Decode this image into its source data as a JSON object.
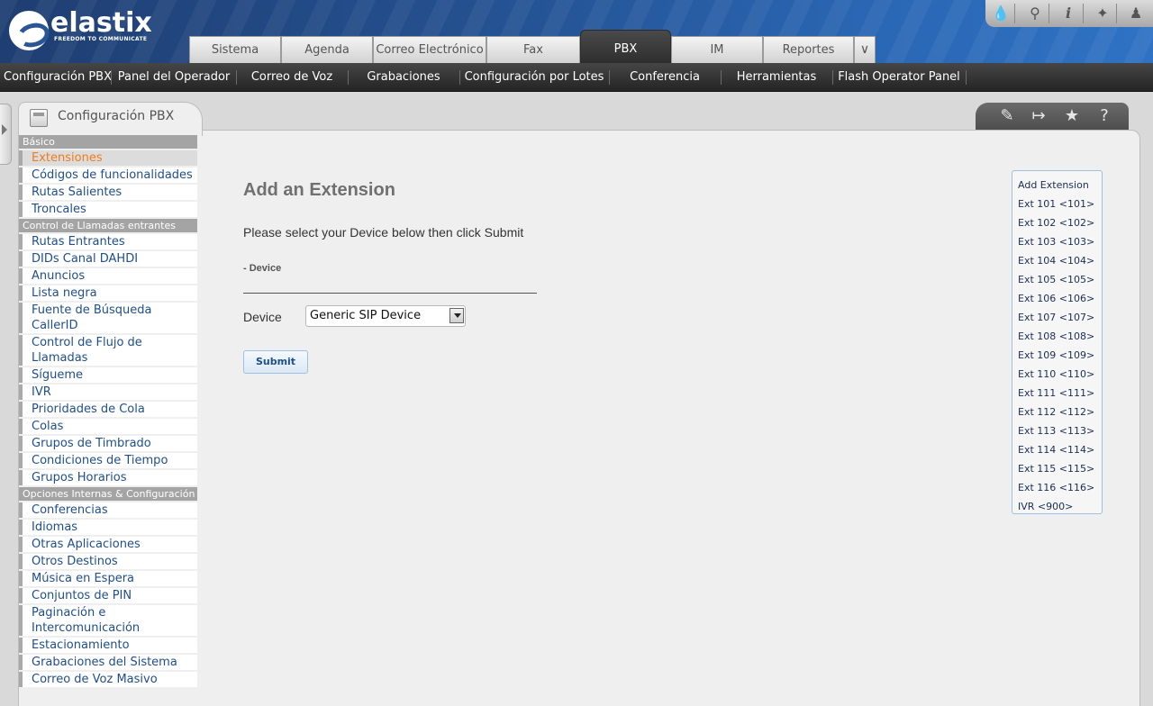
{
  "brand": {
    "name": "elastix",
    "registered": "®",
    "tagline": "FREEDOM TO COMMUNICATE"
  },
  "top_icons": [
    "drop-icon",
    "search-icon",
    "info-icon",
    "addon-icon",
    "user-icon"
  ],
  "main_tabs": [
    {
      "label": "Sistema"
    },
    {
      "label": "Agenda"
    },
    {
      "label": "Correo Electrónico"
    },
    {
      "label": "Fax"
    },
    {
      "label": "PBX",
      "active": true
    },
    {
      "label": "IM"
    },
    {
      "label": "Reportes"
    }
  ],
  "sub_nav": [
    {
      "label": "Configuración PBX",
      "active": true
    },
    {
      "label": "Panel del Operador"
    },
    {
      "label": "Correo de Voz"
    },
    {
      "label": "Grabaciones"
    },
    {
      "label": "Configuración por Lotes"
    },
    {
      "label": "Conferencia"
    },
    {
      "label": "Herramientas"
    },
    {
      "label": "Flash Operator Panel"
    }
  ],
  "page_tab": {
    "title": "Configuración PBX"
  },
  "right_tools": [
    "edit-icon",
    "export-icon",
    "star-icon",
    "help-icon"
  ],
  "sidebar": {
    "sections": [
      {
        "title": "Básico",
        "items": [
          "Extensiones",
          "Códigos de funcionalidades",
          "Rutas Salientes",
          "Troncales"
        ]
      },
      {
        "title": "Control de Llamadas entrantes",
        "items": [
          "Rutas Entrantes",
          "DIDs Canal DAHDI",
          "Anuncios",
          "Lista negra",
          "Fuente de Búsqueda CallerID",
          "Control de Flujo de Llamadas",
          "Sígueme",
          "IVR",
          "Prioridades de Cola",
          "Colas",
          "Grupos de Timbrado",
          "Condiciones de Tiempo",
          "Grupos Horarios"
        ]
      },
      {
        "title": "Opciones Internas & Configuración",
        "items": [
          "Conferencias",
          "Idiomas",
          "Otras Aplicaciones",
          "Otros Destinos",
          "Música en Espera",
          "Conjuntos de PIN",
          "Paginación e Intercomunicación",
          "Estacionamiento",
          "Grabaciones del Sistema",
          "Correo de Voz Masivo"
        ]
      }
    ],
    "active_item": "Extensiones"
  },
  "main": {
    "title": "Add an Extension",
    "instructions": "Please select your Device below then click Submit",
    "section_label": "- Device",
    "device_label": "Device",
    "device_value": "Generic SIP Device",
    "submit_label": "Submit"
  },
  "extensions": [
    "Add Extension",
    "Ext 101 <101>",
    "Ext 102 <102>",
    "Ext 103 <103>",
    "Ext 104 <104>",
    "Ext 105 <105>",
    "Ext 106 <106>",
    "Ext 107 <107>",
    "Ext 108 <108>",
    "Ext 109 <109>",
    "Ext 110 <110>",
    "Ext 111 <111>",
    "Ext 112 <112>",
    "Ext 113 <113>",
    "Ext 114 <114>",
    "Ext 115 <115>",
    "Ext 116 <116>",
    "IVR <900>"
  ]
}
